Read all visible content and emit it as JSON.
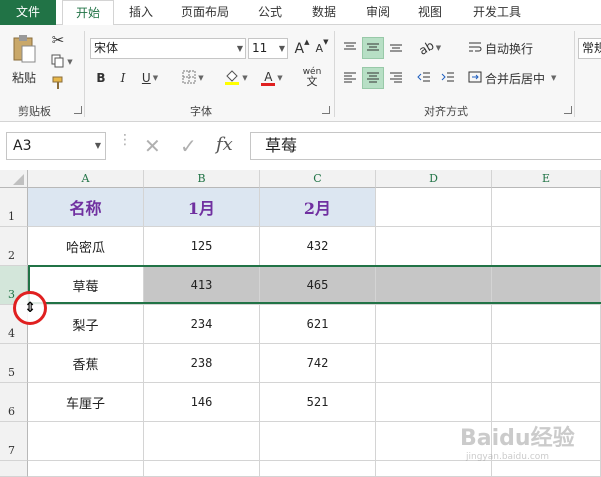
{
  "tabs": [
    "文件",
    "开始",
    "插入",
    "页面布局",
    "公式",
    "数据",
    "审阅",
    "视图",
    "开发工具"
  ],
  "ribbon": {
    "clipboard": {
      "paste_label": "粘贴",
      "group_label": "剪贴板"
    },
    "font": {
      "family": "宋体",
      "size": "11",
      "bold": "B",
      "italic": "I",
      "underline": "U",
      "grow": "A",
      "shrink": "A",
      "font_color_glyph": "A",
      "phonetic": "wén",
      "group_label": "字体"
    },
    "alignment": {
      "wrap_text": "自动换行",
      "merge_center": "合并后居中",
      "group_label": "对齐方式"
    },
    "number": {
      "format": "常规"
    }
  },
  "formula_bar": {
    "name_box": "A3",
    "cancel": "✕",
    "enter": "✓",
    "fx": "fx",
    "content": "草莓"
  },
  "columns": [
    "A",
    "B",
    "C",
    "D",
    "E"
  ],
  "rows": [
    "1",
    "2",
    "3",
    "4",
    "5",
    "6",
    "7"
  ],
  "table": {
    "headers": [
      "名称",
      "1月",
      "2月"
    ],
    "data": [
      [
        "哈密瓜",
        "125",
        "432"
      ],
      [
        "草莓",
        "413",
        "465"
      ],
      [
        "梨子",
        "234",
        "621"
      ],
      [
        "香蕉",
        "238",
        "742"
      ],
      [
        "车厘子",
        "146",
        "521"
      ]
    ]
  },
  "cursor_glyph": "⇕",
  "watermark": {
    "main": "Baidu经验",
    "sub": "jingyan.baidu.com"
  },
  "colors": {
    "accent": "#217346",
    "header_fill": "#dce6f1",
    "header_text": "#7030a0",
    "selection_fill": "#c6c6c6",
    "cursor_ring": "#e02020"
  }
}
